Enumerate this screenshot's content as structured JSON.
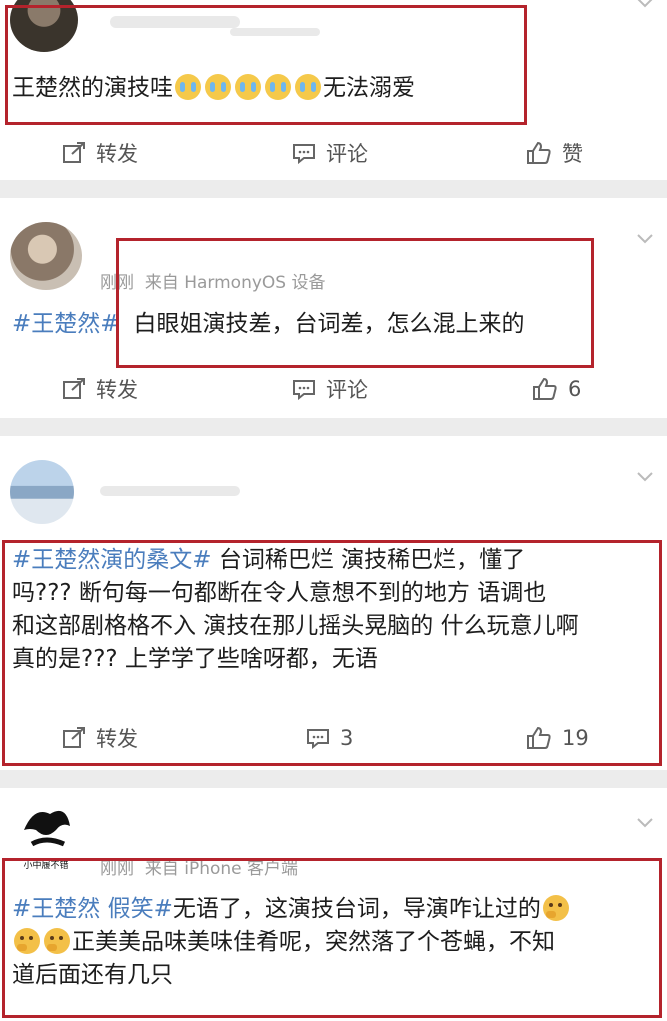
{
  "post1": {
    "body_text": "王楚然的演技哇",
    "body_text_after": "无法溺爱",
    "actions": {
      "repost": "转发",
      "comment": "评论",
      "like": "赞"
    }
  },
  "post2": {
    "time": "刚刚",
    "source": "来自 HarmonyOS 设备",
    "hashtag": "#王楚然#",
    "body_text": "白眼姐演技差，台词差，怎么混上来的",
    "actions": {
      "repost": "转发",
      "comment": "评论",
      "like": "6"
    }
  },
  "post3": {
    "hashtag": "#王楚然演的桑文#",
    "body_line1": "台词稀巴烂 演技稀巴烂，懂了",
    "body_line2": "吗??? 断句每一句都断在令人意想不到的地方 语调也",
    "body_line3": "和这部剧格格不入 演技在那儿摇头晃脑的 什么玩意儿啊",
    "body_line4": "真的是??? 上学学了些啥呀都，无语",
    "actions": {
      "repost": "转发",
      "comment": "3",
      "like": "19"
    }
  },
  "post4": {
    "avatar_text": "小中履不错",
    "time": "刚刚",
    "source": "来自 iPhone 客户端",
    "hashtag": "#王楚然 假笑#",
    "body_line1": "无语了，这演技台词，导演咋让过的",
    "body_line2": "正美美品味美味佳肴呢，突然落了个苍蝇，不知",
    "body_line3": "道后面还有几只"
  },
  "colors": {
    "accent_link": "#4a7dbd",
    "highlight_box": "#b4232c",
    "page_bg": "#ececec"
  }
}
